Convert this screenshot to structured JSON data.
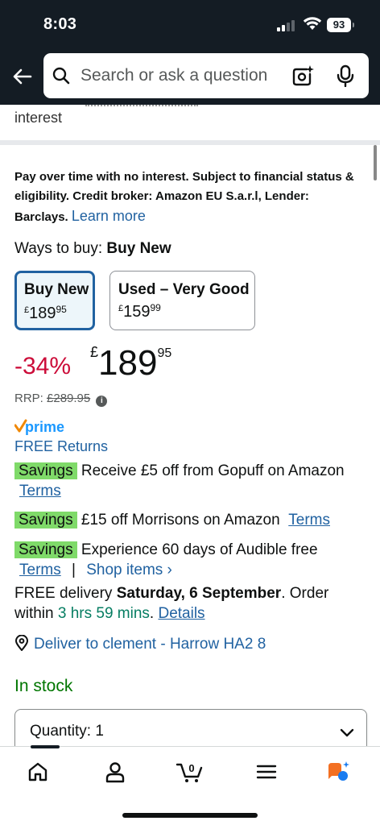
{
  "status_bar": {
    "time": "8:03",
    "battery": "93"
  },
  "header": {
    "search_placeholder": "Search or ask a question"
  },
  "content": {
    "interest_partial": "interest",
    "finance_text": "Pay over time with no interest. Subject to financial status & eligibility. Credit broker: Amazon EU S.a.r.l, Lender: Barclays.",
    "learn_more": "Learn more",
    "ways_label": "Ways to buy:",
    "ways_value": "Buy New",
    "options": [
      {
        "title": "Buy New",
        "currency": "£",
        "whole": "189",
        "fraction": "95"
      },
      {
        "title": "Used – Very Good",
        "currency": "£",
        "whole": "159",
        "fraction": "99"
      }
    ],
    "discount": "-34%",
    "price": {
      "currency": "£",
      "whole": "189",
      "fraction": "95"
    },
    "rrp_label": "RRP:",
    "rrp_value": "£289.95",
    "prime_label": "prime",
    "free_returns": "FREE Returns",
    "savings": [
      {
        "badge": "Savings",
        "text": "Receive £5 off from Gopuff on Amazon",
        "terms": "Terms"
      },
      {
        "badge": "Savings",
        "text": "£15 off Morrisons on Amazon",
        "terms": "Terms"
      },
      {
        "badge": "Savings",
        "text": "Experience 60 days of Audible free",
        "terms": "Terms",
        "separator": "|",
        "shop": "Shop items ›"
      }
    ],
    "delivery": {
      "prefix": "FREE delivery",
      "date": "Saturday, 6 September",
      "middle": ". Order within",
      "countdown": "3 hrs 59 mins",
      "period": ".",
      "details": "Details"
    },
    "deliver_to": "Deliver to clement - Harrow HA2 8",
    "stock": "In stock",
    "quantity": "Quantity: 1"
  },
  "colors": {
    "accent": "#2162a1",
    "discount": "#cc0c39",
    "savings_badge": "#7fda69",
    "stock": "#007600",
    "header_bg": "#141c24"
  },
  "icons": [
    "back-arrow-icon",
    "search-icon",
    "camera-icon",
    "mic-icon",
    "info-icon",
    "location-pin-icon",
    "chevron-down-icon",
    "home-icon",
    "account-icon",
    "cart-icon",
    "menu-icon",
    "rufus-icon"
  ],
  "nav": {
    "cart_count": "0"
  }
}
